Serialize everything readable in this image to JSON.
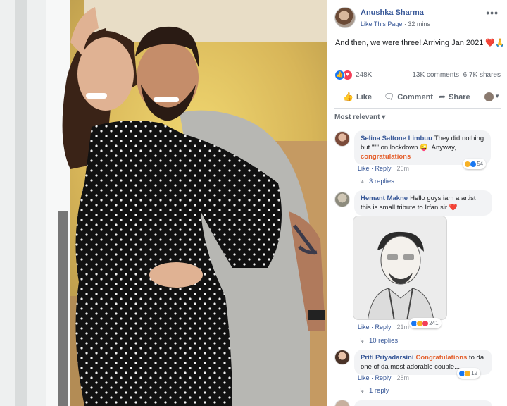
{
  "post": {
    "page_name": "Anushka Sharma",
    "like_page": "Like This Page",
    "separator": " · ",
    "time": "32 mins",
    "more": "•••",
    "caption": "And then, we were three! Arriving Jan 2021",
    "caption_emoji": "❤️🙏"
  },
  "stats": {
    "reactions_count": "248K",
    "comments": "13K comments",
    "shares": "6.7K shares"
  },
  "actions": {
    "like": "Like",
    "comment": "Comment",
    "share": "Share"
  },
  "sort_label": "Most relevant ▾",
  "comments": [
    {
      "name": "Selina Saltone Limbuu",
      "text": "They did nothing but \"\"\" on lockdown 😜. Anyway,",
      "tag": "congratulations",
      "like": "Like",
      "reply": "Reply",
      "time": "26m",
      "reaction_count": "54",
      "replies": "3 replies"
    },
    {
      "name": "Hemant Makne",
      "text": "Hello guys iam a artist this is small tribute to Irfan sir",
      "emoji": "❤️",
      "like": "Like",
      "reply": "Reply",
      "time": "21m",
      "reaction_count": "241",
      "replies": "10 replies"
    },
    {
      "name": "Priti Priyadarsini",
      "tag": "Congratulations",
      "text": "to da one of da most adorable couple...",
      "like": "Like",
      "reply": "Reply",
      "time": "28m",
      "reaction_count": "12",
      "replies": "1 reply"
    }
  ],
  "colors": {
    "link_blue": "#385898",
    "meta_gray": "#606770",
    "like_blue": "#1877f2",
    "love_red": "#f33e58",
    "tag_orange": "#e4602e"
  }
}
